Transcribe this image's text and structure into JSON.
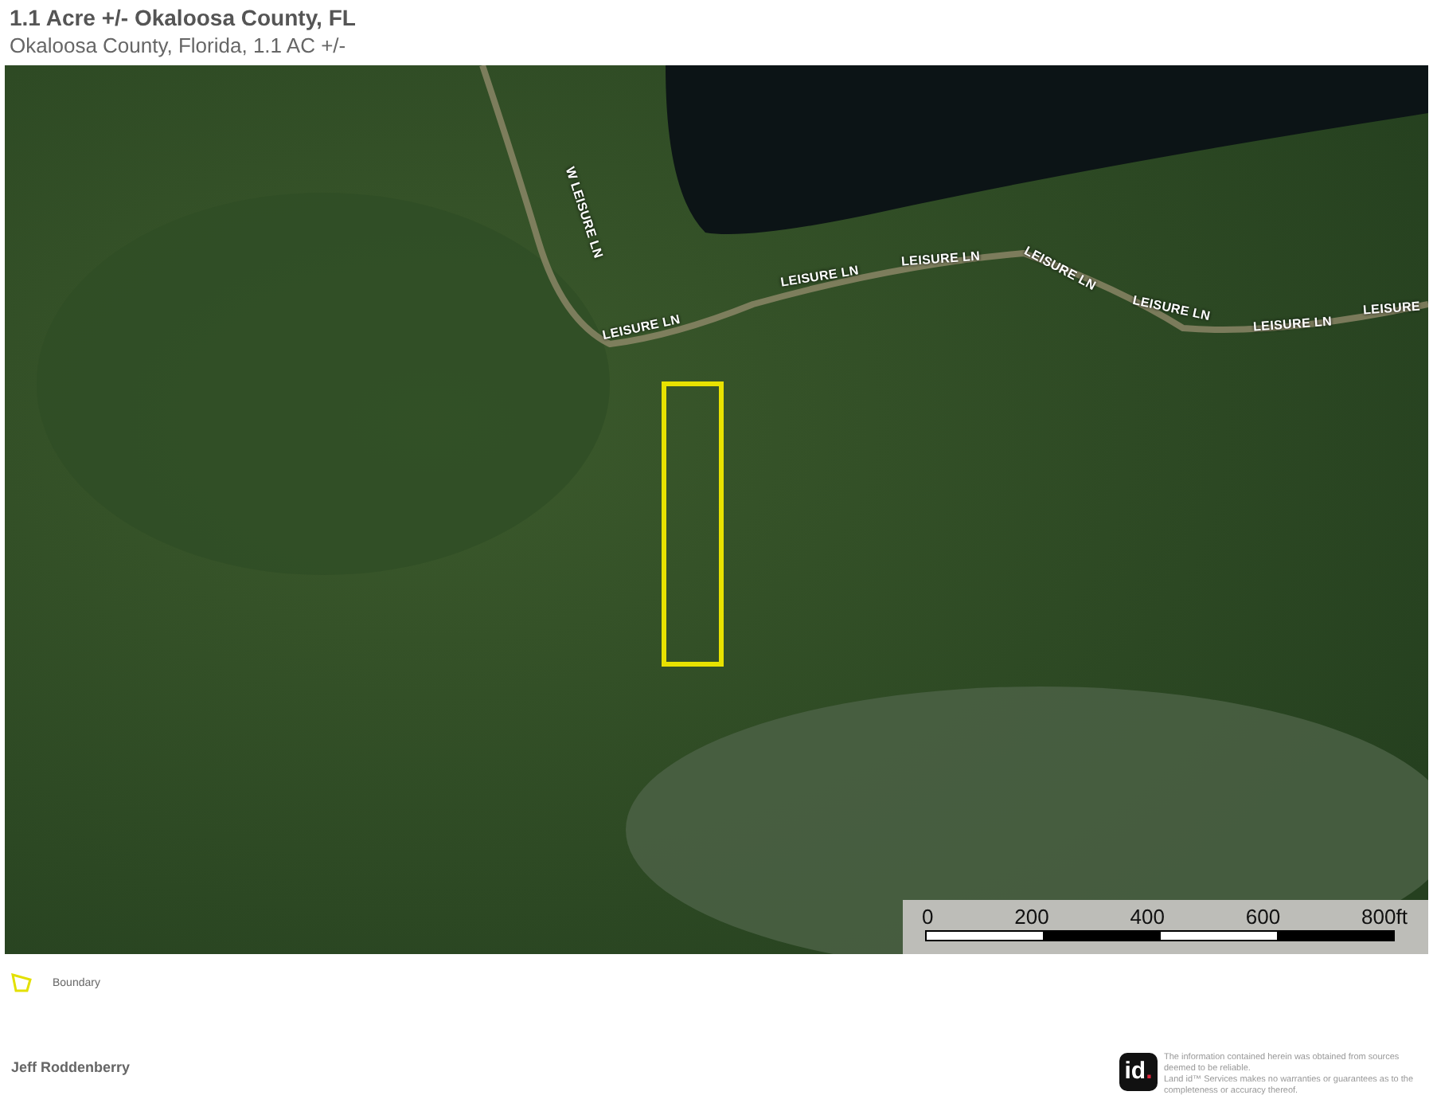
{
  "title": "1.1 Acre +/- Okaloosa County, FL",
  "subtitle": "Okaloosa County, Florida, 1.1 AC +/-",
  "map": {
    "road_labels": [
      {
        "text": "W LEISURE LN"
      },
      {
        "text": "LEISURE LN"
      },
      {
        "text": "LEISURE LN"
      },
      {
        "text": "LEISURE LN"
      },
      {
        "text": "LEISURE LN"
      },
      {
        "text": "LEISURE LN"
      },
      {
        "text": "LEISURE LN"
      },
      {
        "text": "LEISURE"
      }
    ],
    "scale_bar": {
      "labels": [
        "0",
        "200",
        "400",
        "600",
        "800ft"
      ]
    }
  },
  "legend": [
    {
      "label": "Boundary",
      "color": "#e3e000"
    }
  ],
  "agent": "Jeff Roddenberry",
  "logo": {
    "text": "id",
    "dot": "."
  },
  "disclaimer": [
    "The information contained herein was obtained from sources deemed to be reliable.",
    "Land id™ Services makes no warranties or guarantees as to the completeness or accuracy thereof."
  ]
}
